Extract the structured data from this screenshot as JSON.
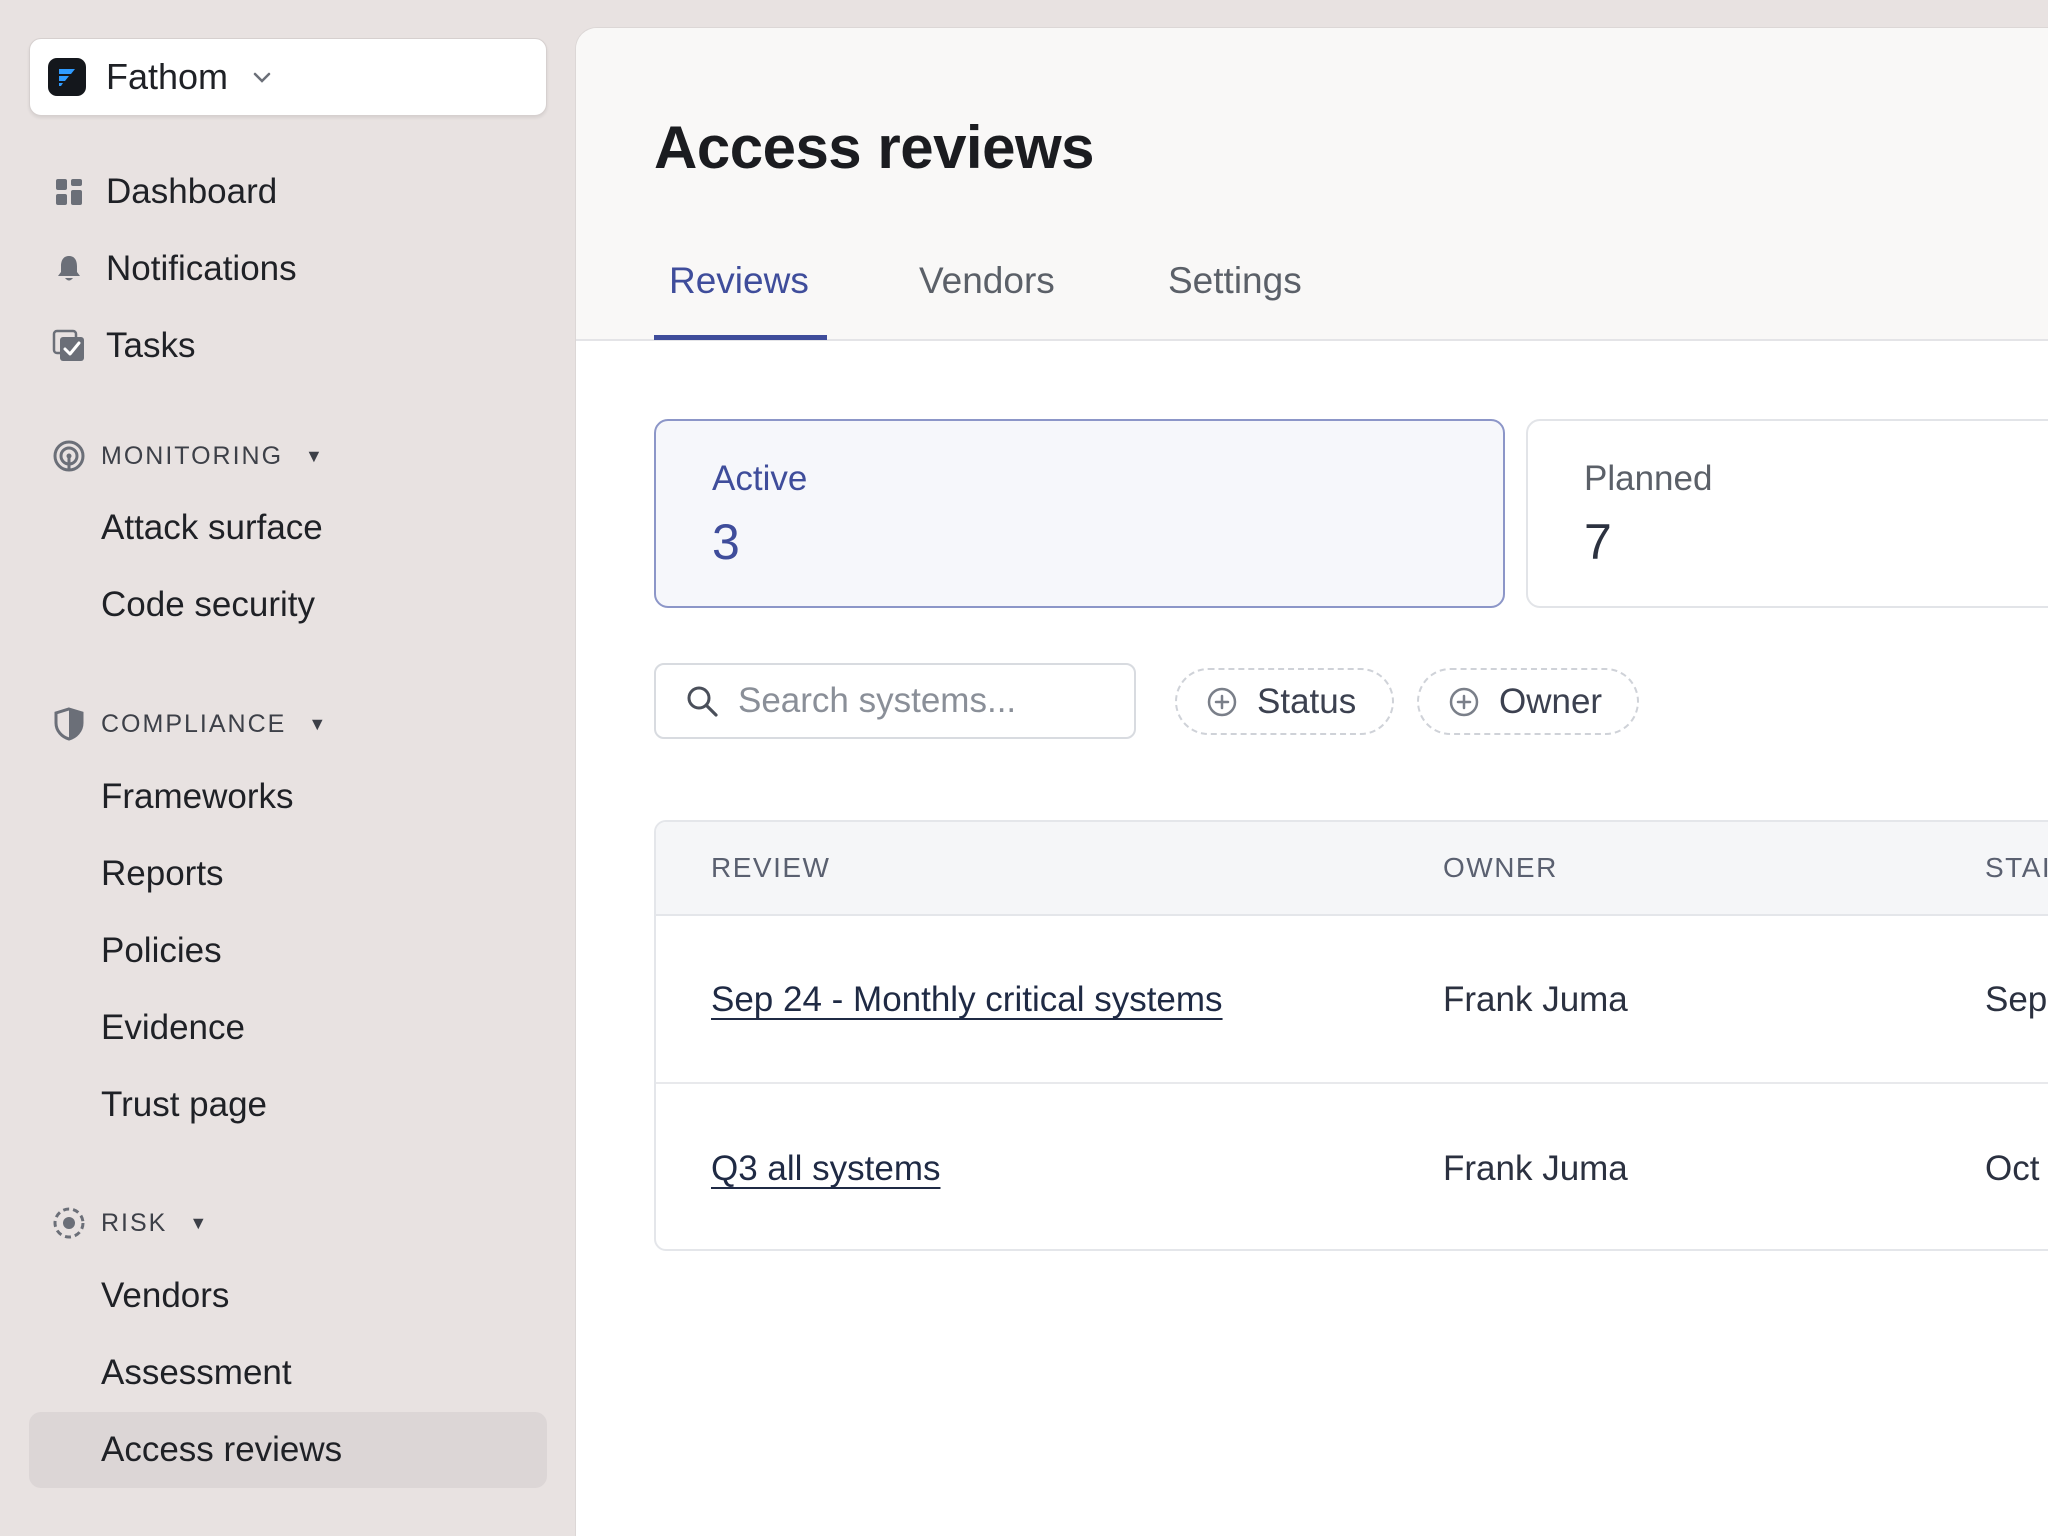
{
  "org": {
    "name": "Fathom"
  },
  "nav": {
    "top": [
      {
        "label": "Dashboard",
        "icon": "dashboard-icon"
      },
      {
        "label": "Notifications",
        "icon": "bell-icon"
      },
      {
        "label": "Tasks",
        "icon": "tasks-icon"
      }
    ],
    "sections": {
      "monitoring": {
        "title": "MONITORING",
        "items": [
          "Attack surface",
          "Code security"
        ]
      },
      "compliance": {
        "title": "COMPLIANCE",
        "items": [
          "Frameworks",
          "Reports",
          "Policies",
          "Evidence",
          "Trust page"
        ]
      },
      "risk": {
        "title": "RISK",
        "items": [
          "Vendors",
          "Assessment",
          "Access reviews"
        ]
      }
    },
    "active_item": "Access reviews"
  },
  "page": {
    "title": "Access reviews",
    "tabs": [
      "Reviews",
      "Vendors",
      "Settings"
    ],
    "active_tab": "Reviews"
  },
  "stats": [
    {
      "label": "Active",
      "value": "3"
    },
    {
      "label": "Planned",
      "value": "7"
    }
  ],
  "search": {
    "placeholder": "Search systems..."
  },
  "filters": [
    "Status",
    "Owner"
  ],
  "table": {
    "columns": [
      "REVIEW",
      "OWNER",
      "STAI"
    ],
    "rows": [
      {
        "review": "Sep 24 - Monthly critical systems",
        "owner": "Frank Juma",
        "start": "Sep"
      },
      {
        "review": "Q3 all systems",
        "owner": "Frank Juma",
        "start": "Oct"
      }
    ]
  },
  "colors": {
    "accent": "#3f4d9b",
    "sidebar_bg": "#e8e2e1",
    "active_nav_bg": "#dcd6d6"
  }
}
